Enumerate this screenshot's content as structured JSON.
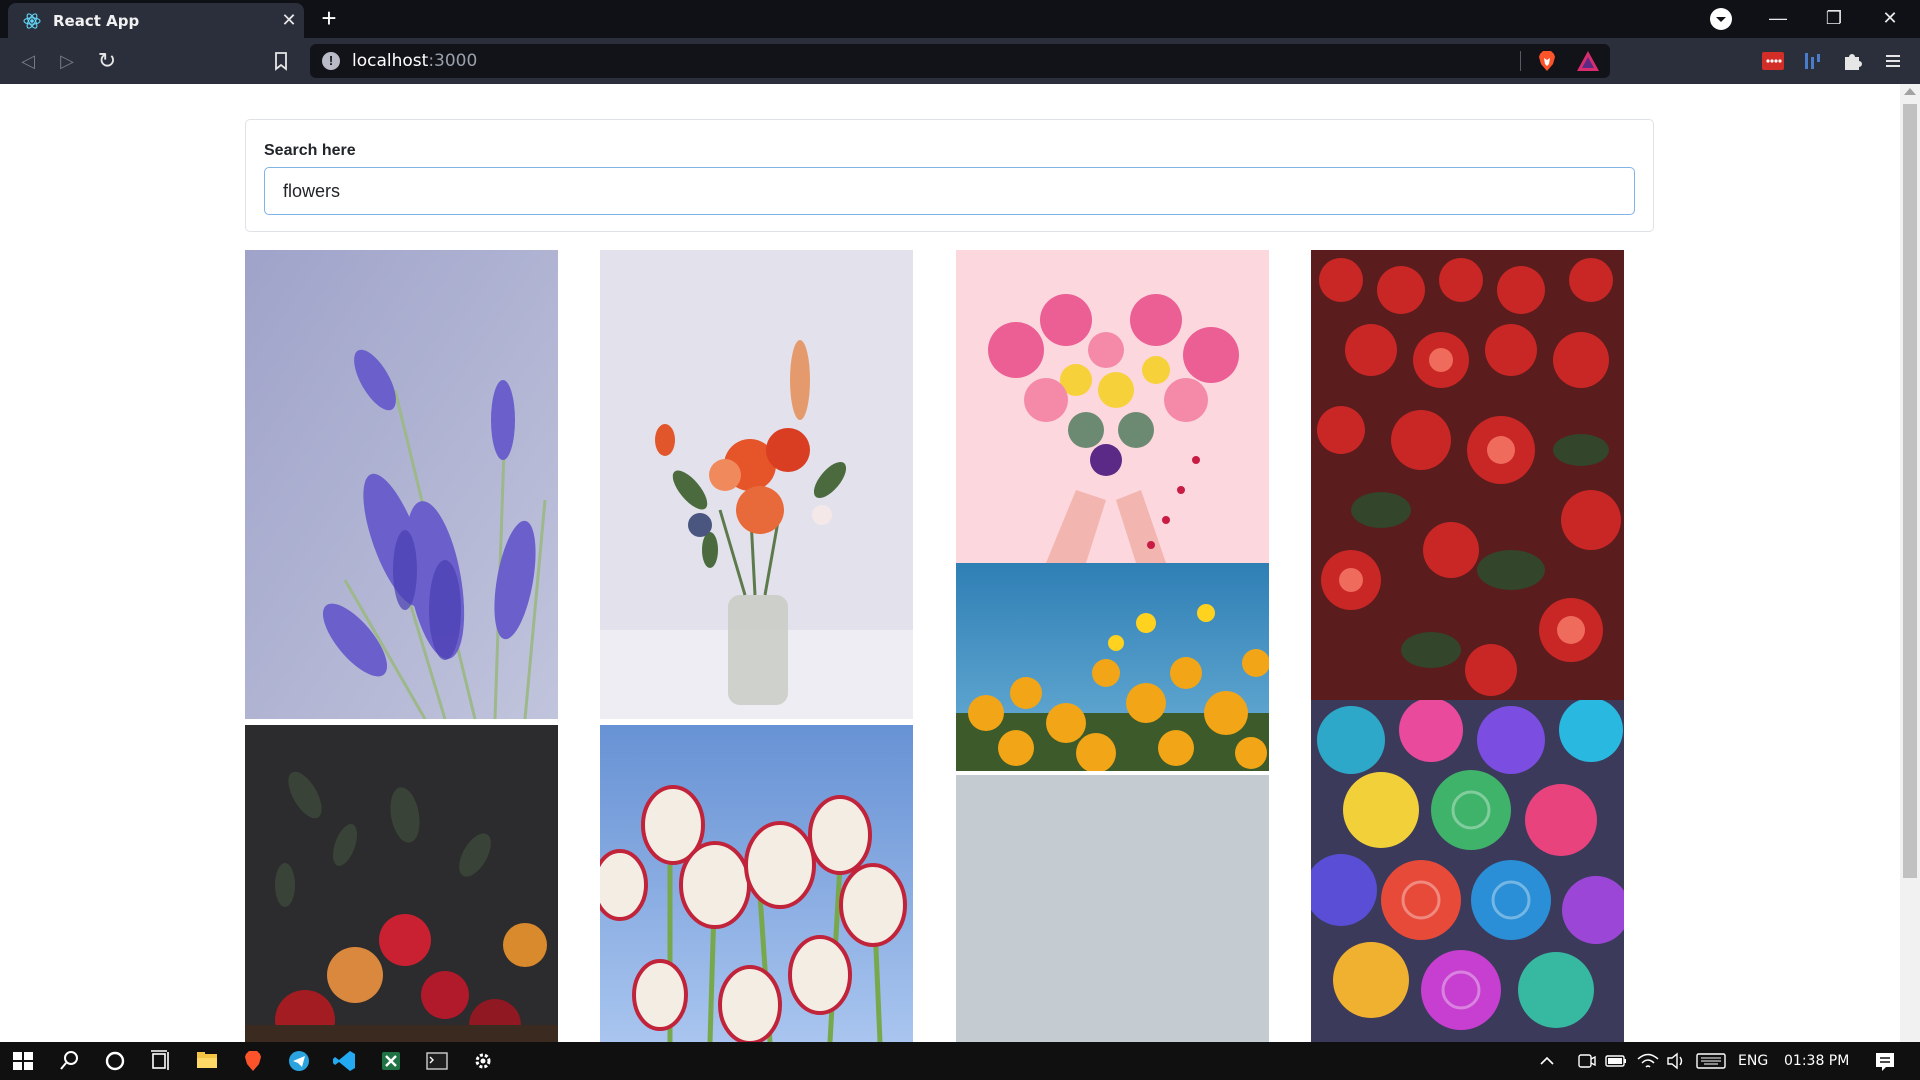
{
  "browser": {
    "tab_title": "React App",
    "tab_close": "✕",
    "new_tab": "+",
    "url_host": "localhost",
    "url_port": ":3000",
    "window_controls": {
      "minimize": "—",
      "restore": "❐",
      "close": "✕"
    },
    "nav": {
      "back": "◁",
      "forward": "▷",
      "reload": "↻"
    }
  },
  "search": {
    "label": "Search here",
    "value": "flowers"
  },
  "gallery": {
    "photos": [
      {
        "subject": "lavender",
        "column": 1
      },
      {
        "subject": "bouquet-in-vase",
        "column": 2
      },
      {
        "subject": "heart-flowers-hands",
        "column": 3
      },
      {
        "subject": "red-begonias",
        "column": 4
      },
      {
        "subject": "dark-red-roses",
        "column": 1
      },
      {
        "subject": "red-white-tulips",
        "column": 2
      },
      {
        "subject": "yellow-poppies-sky",
        "column": 3
      },
      {
        "subject": "rainbow-roses",
        "column": 4
      },
      {
        "subject": "grey-placeholder",
        "column": 3
      }
    ]
  },
  "taskbar": {
    "language": "ENG",
    "time": "01:38 PM"
  },
  "colors": {
    "titlebar": "#0f1117",
    "toolbar": "#2b2e3b",
    "input_border": "#80b4e6",
    "taskbar": "#101010"
  }
}
